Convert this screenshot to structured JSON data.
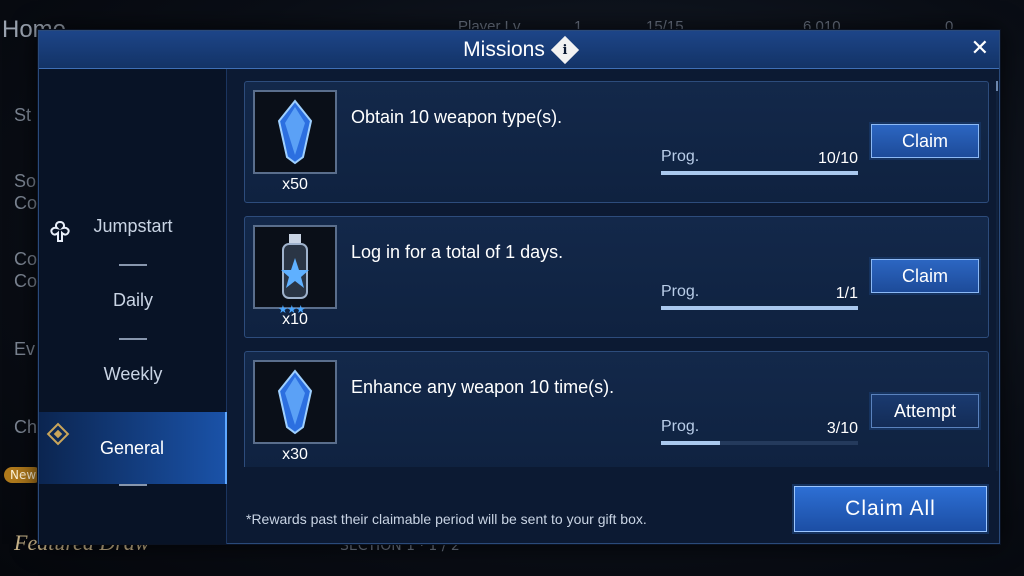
{
  "background": {
    "home": "Home",
    "side_items": [
      "St",
      "So",
      "Co",
      "Co",
      "Co",
      "Ev",
      "Ch"
    ],
    "player_lv": "Player Lv.",
    "player_lv_value": "1",
    "stamina": "15/15",
    "currency": "6,010",
    "gems": "0",
    "new_badge": "New",
    "featured": "Featured Draw",
    "bottom_text": "SECTION 1 · 1 / 2"
  },
  "dialog": {
    "title": "Missions",
    "info_icon": "i",
    "close_icon": "✕"
  },
  "sidebar": {
    "items": [
      {
        "label": "Jumpstart",
        "active": false
      },
      {
        "label": "Daily",
        "active": false
      },
      {
        "label": "Weekly",
        "active": false
      },
      {
        "label": "General",
        "active": true
      }
    ]
  },
  "missions": [
    {
      "text": "Obtain 10 weapon type(s).",
      "reward_icon": "blue-crystal-icon",
      "reward_count": "x50",
      "prog_label": "Prog.",
      "progress": "10/10",
      "progress_fraction": 1.0,
      "button": "Claim",
      "button_state": "claim"
    },
    {
      "text": "Log in for a total of 1 days.",
      "reward_icon": "potion-bottle-icon",
      "reward_stars": "★★★",
      "reward_count": "x10",
      "prog_label": "Prog.",
      "progress": "1/1",
      "progress_fraction": 1.0,
      "button": "Claim",
      "button_state": "claim"
    },
    {
      "text": "Enhance any weapon 10 time(s).",
      "reward_icon": "blue-crystal-icon",
      "reward_count": "x30",
      "prog_label": "Prog.",
      "progress": "3/10",
      "progress_fraction": 0.3,
      "button": "Attempt",
      "button_state": "attempt"
    }
  ],
  "footer": {
    "note": "*Rewards past their claimable period will be sent to your gift box.",
    "claim_all": "Claim All"
  },
  "colors": {
    "accent": "#2d6fd4",
    "panel": "#0c1a33",
    "progress_fill": "#a9c8ee"
  }
}
